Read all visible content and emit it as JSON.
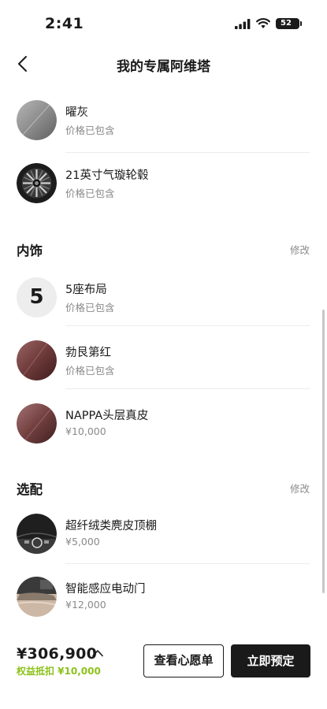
{
  "status_bar": {
    "time": "2:41",
    "battery": "52"
  },
  "nav": {
    "title": "我的专属阿维塔",
    "back_icon": "chevron-left-icon"
  },
  "exterior_items": [
    {
      "title": "曜灰",
      "subtitle": "价格已包含",
      "swatch": "gray-paint-swatch",
      "color": "#8f8f8f"
    },
    {
      "title": "21英寸气璇轮毂",
      "subtitle": "价格已包含",
      "swatch": "wheel-swatch",
      "color": "#2a2a2a"
    }
  ],
  "interior": {
    "section_title": "内饰",
    "edit_label": "修改",
    "items": [
      {
        "title": "5座布局",
        "subtitle": "价格已包含",
        "badge": "5"
      },
      {
        "title": "勃艮第红",
        "subtitle": "价格已包含",
        "color": "#6e3a3a"
      },
      {
        "title": "NAPPA头层真皮",
        "subtitle": "¥10,000",
        "color": "#6e3a3a"
      }
    ]
  },
  "options": {
    "section_title": "选配",
    "edit_label": "修改",
    "items": [
      {
        "title": "超纤绒类麂皮顶棚",
        "subtitle": "¥5,000",
        "swatch": "headliner-swatch"
      },
      {
        "title": "智能感应电动门",
        "subtitle": "¥12,000",
        "swatch": "door-swatch"
      }
    ]
  },
  "bottom_bar": {
    "price": "¥306,900",
    "benefit": "权益抵扣 ¥10,000",
    "wishlist_label": "查看心愿单",
    "order_label": "立即预定",
    "benefit_color": "#8cc21b"
  }
}
